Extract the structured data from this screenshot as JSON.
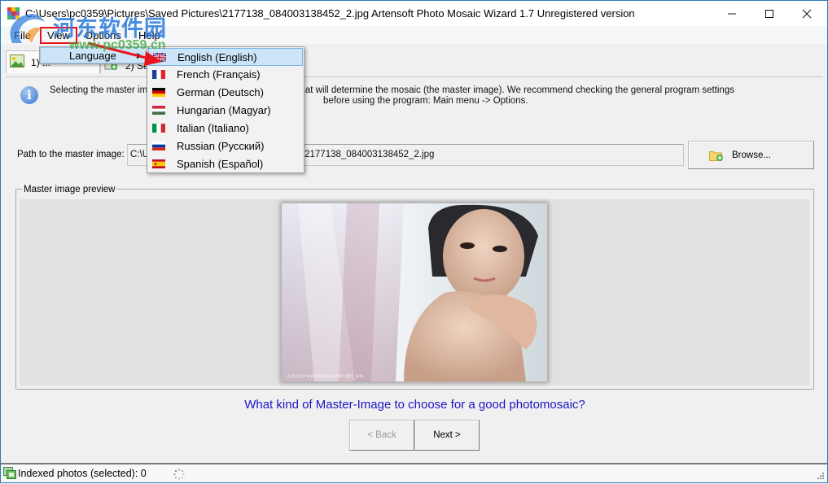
{
  "window": {
    "title": "C:\\Users\\pc0359\\Pictures\\Saved Pictures\\2177138_084003138452_2.jpg Artensoft Photo Mosaic Wizard 1.7  Unregistered version",
    "controls": {
      "minimize": "—",
      "maximize": "☐",
      "close": "✕"
    }
  },
  "menubar": {
    "items": [
      {
        "label": "File"
      },
      {
        "label": "View"
      },
      {
        "label": "Options"
      },
      {
        "label": "Help"
      }
    ]
  },
  "view_menu": {
    "items": [
      {
        "label": "Language",
        "submenu_arrow": "▶"
      }
    ]
  },
  "language_menu": {
    "items": [
      {
        "label": "English (English)",
        "flag": "uk-flag",
        "selected": true
      },
      {
        "label": "French (Français)",
        "flag": "france-flag"
      },
      {
        "label": "German (Deutsch)",
        "flag": "germany-flag"
      },
      {
        "label": "Hungarian (Magyar)",
        "flag": "hungary-flag"
      },
      {
        "label": "Italian (Italiano)",
        "flag": "italy-flag"
      },
      {
        "label": "Russian (Русский)",
        "flag": "russia-flag"
      },
      {
        "label": "Spanish (Español)",
        "flag": "spain-flag"
      }
    ]
  },
  "tabs": [
    {
      "label": "1) ...",
      "active": true
    },
    {
      "label": "2) Sel...",
      "active": false
    }
  ],
  "info": {
    "line1": "Selecting the master image. Use this step to load the photo that will determine the mosaic (the master image). We recommend checking the general program settings",
    "line1_visible_left": "Selecting the master ima",
    "line1_visible_right": "o load the photo that will determine the mosaic (the master image). We recommend checking the general program settings",
    "line2": "before using the program: Main menu -> Options."
  },
  "path": {
    "label": "Path to the master image:",
    "value_visible_left": "C:\\U",
    "value_visible_right": "2177138_084003138452_2.jpg",
    "value": "C:\\Users\\pc0359\\Pictures\\Saved Pictures\\2177138_084003138452_2.jpg"
  },
  "browse_button": {
    "label": "Browse..."
  },
  "preview": {
    "legend": "Master image preview",
    "image_caption": "master-image-portrait"
  },
  "help_link": {
    "label": "What kind of Master-Image to choose for a good photomosaic?"
  },
  "nav": {
    "back_label": "< Back",
    "next_label": "Next >",
    "back_enabled": false
  },
  "status": {
    "text": "Indexed photos (selected): 0"
  },
  "watermark": {
    "main": "河东软件园",
    "url": "www.pc0359.cn"
  },
  "colors": {
    "link": "#1b16c4",
    "menu_highlight": "#cce4f7",
    "annotation_red": "#e8131b",
    "window_border": "#2b7ab8"
  }
}
